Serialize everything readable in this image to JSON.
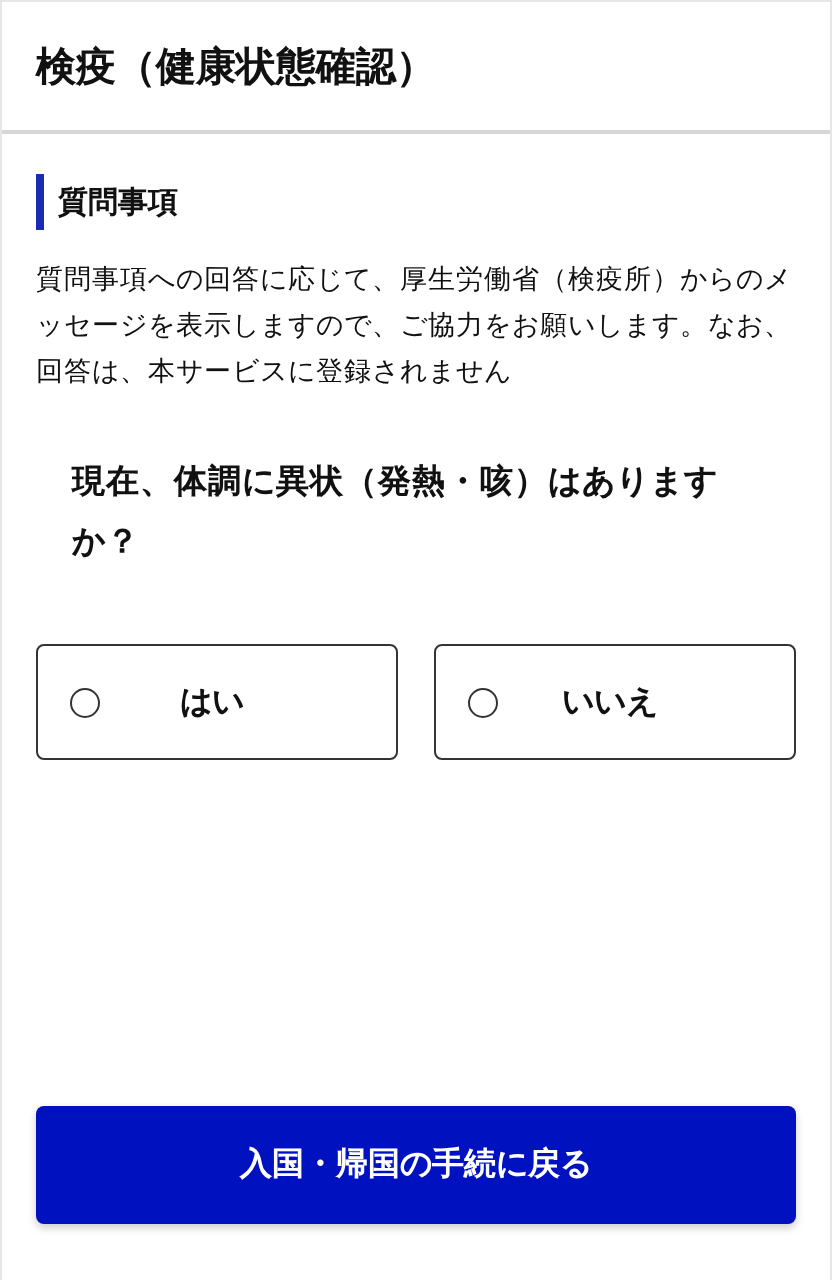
{
  "header": {
    "title": "検疫（健康状態確認）"
  },
  "section": {
    "heading": "質問事項",
    "description": "質問事項への回答に応じて、厚生労働省（検疫所）からのメッセージを表示しますので、ご協力をお願いします。なお、回答は、本サービスに登録されません"
  },
  "question": {
    "text": "現在、体調に異状（発熱・咳）はありますか？",
    "options": [
      {
        "label": "はい",
        "selected": false
      },
      {
        "label": "いいえ",
        "selected": false
      }
    ]
  },
  "footer_button": {
    "label": "入国・帰国の手続に戻る"
  }
}
